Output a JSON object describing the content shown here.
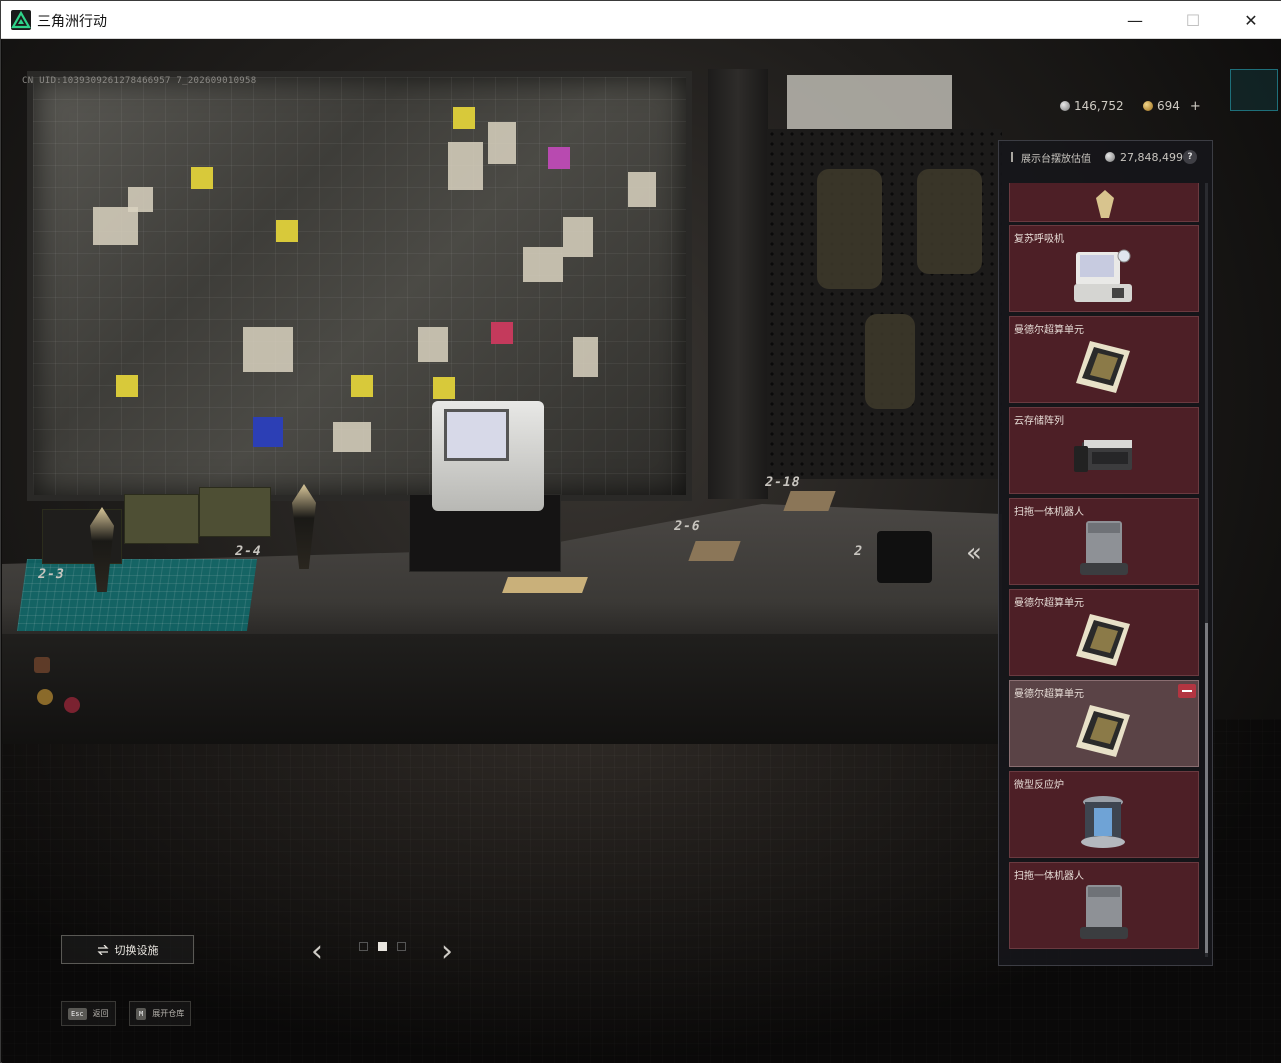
{
  "window": {
    "title": "三角洲行动",
    "minimize_symbol": "—",
    "maximize_symbol": "☐",
    "close_symbol": "✕"
  },
  "hud": {
    "uid": "CN UID:1039309261278466957 7_202609010958",
    "silver_amount": "146,752",
    "gold_amount": "694",
    "plus_symbol": "+"
  },
  "scene": {
    "slot_labels": [
      "2-3",
      "2-4",
      "2-6",
      "2-18",
      "2"
    ]
  },
  "panel": {
    "header_label": "展示台摆放估值",
    "header_value": "27,848,499",
    "help_symbol": "?",
    "items": [
      {
        "label": "",
        "icon": "trophy-icon",
        "selected": false
      },
      {
        "label": "复苏呼吸机",
        "icon": "ventilator-icon",
        "selected": false
      },
      {
        "label": "曼德尔超算单元",
        "icon": "compute-unit-icon",
        "selected": false
      },
      {
        "label": "云存储阵列",
        "icon": "storage-array-icon",
        "selected": false
      },
      {
        "label": "扫拖一体机器人",
        "icon": "robot-vacuum-icon",
        "selected": false
      },
      {
        "label": "曼德尔超算单元",
        "icon": "compute-unit-icon",
        "selected": false
      },
      {
        "label": "曼德尔超算单元",
        "icon": "compute-unit-icon",
        "selected": true
      },
      {
        "label": "微型反应炉",
        "icon": "reactor-icon",
        "selected": false
      },
      {
        "label": "扫拖一体机器人",
        "icon": "robot-vacuum-icon",
        "selected": false
      }
    ]
  },
  "controls": {
    "collapse_symbol": "«",
    "switch_button_label": "切换设施",
    "prev_symbol": "‹",
    "next_symbol": "›",
    "page_count": 3,
    "active_page": 2,
    "hints": [
      {
        "key": "Esc",
        "label": "返回"
      },
      {
        "key": "M",
        "label": "展开仓库"
      }
    ]
  },
  "colors": {
    "card_bg": "#4d1f26",
    "card_selected_bg": "#5a4346",
    "remove_button": "#b33541",
    "teal_mat": "#0e6b6c"
  }
}
